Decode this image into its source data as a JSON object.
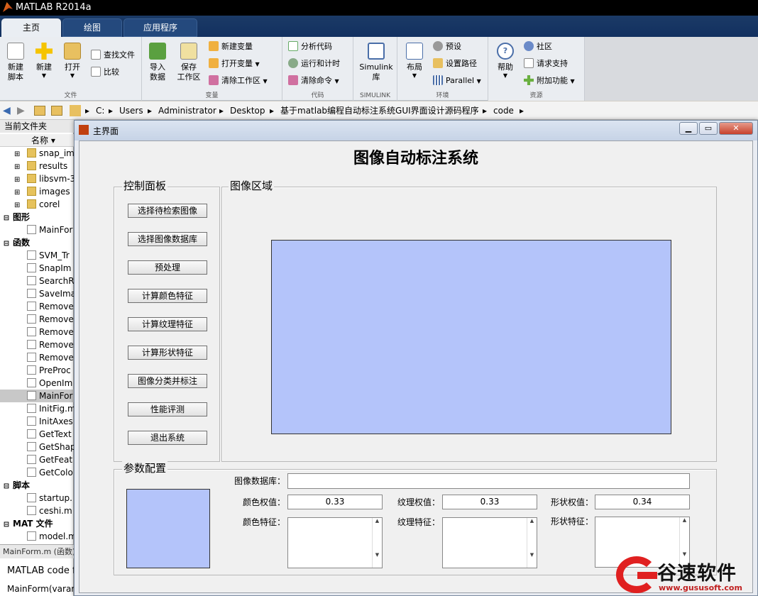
{
  "app": {
    "title": "MATLAB R2014a"
  },
  "tabs": [
    {
      "label": "主页",
      "active": true
    },
    {
      "label": "绘图",
      "active": false
    },
    {
      "label": "应用程序",
      "active": false
    }
  ],
  "ribbon": {
    "file": {
      "section": "文件",
      "new_script": "新建\n脚本",
      "new": "新建",
      "open": "打开",
      "find_files": "查找文件",
      "compare": "比较"
    },
    "variable": {
      "section": "变量",
      "import": "导入\n数据",
      "save_ws": "保存\n工作区",
      "new_var": "新建变量",
      "open_var": "打开变量",
      "clear_ws": "清除工作区"
    },
    "code": {
      "section": "代码",
      "analyze": "分析代码",
      "run_time": "运行和计时",
      "clear_cmd": "清除命令"
    },
    "simulink": {
      "section": "SIMULINK",
      "label": "Simulink\n库"
    },
    "env": {
      "section": "环境",
      "layout": "布局",
      "prefs": "预设",
      "set_path": "设置路径",
      "parallel": "Parallel"
    },
    "resources": {
      "section": "资源",
      "help": "帮助",
      "community": "社区",
      "support": "请求支持",
      "addons": "附加功能"
    }
  },
  "address": {
    "sep": "▸",
    "parts": [
      "C:",
      "Users",
      "Administrator",
      "Desktop",
      "基于matlab编程自动标注系统GUI界面设计源码程序",
      "code"
    ]
  },
  "file_panel": {
    "title": "当前文件夹",
    "col_name": "名称 ▾",
    "items": [
      {
        "label": "snap_im",
        "type": "folder"
      },
      {
        "label": "results",
        "type": "folder"
      },
      {
        "label": "libsvm-3",
        "type": "folder"
      },
      {
        "label": "images",
        "type": "folder"
      },
      {
        "label": "corel",
        "type": "folder"
      },
      {
        "label": "图形",
        "type": "cat"
      },
      {
        "label": "MainFor",
        "type": "file"
      },
      {
        "label": "函数",
        "type": "cat"
      },
      {
        "label": "SVM_Tr",
        "type": "file"
      },
      {
        "label": "SnapIm",
        "type": "file"
      },
      {
        "label": "SearchR",
        "type": "file"
      },
      {
        "label": "SaveIma",
        "type": "file"
      },
      {
        "label": "Remove",
        "type": "file"
      },
      {
        "label": "Remove",
        "type": "file"
      },
      {
        "label": "Remove",
        "type": "file"
      },
      {
        "label": "Remove",
        "type": "file"
      },
      {
        "label": "Remove",
        "type": "file"
      },
      {
        "label": "PreProc",
        "type": "file"
      },
      {
        "label": "OpenIm",
        "type": "file"
      },
      {
        "label": "MainFor",
        "type": "file",
        "selected": true
      },
      {
        "label": "InitFig.m",
        "type": "file"
      },
      {
        "label": "InitAxes",
        "type": "file"
      },
      {
        "label": "GetText",
        "type": "file"
      },
      {
        "label": "GetShap",
        "type": "file"
      },
      {
        "label": "GetFeat",
        "type": "file"
      },
      {
        "label": "GetColo",
        "type": "file"
      },
      {
        "label": "脚本",
        "type": "cat"
      },
      {
        "label": "startup.",
        "type": "file"
      },
      {
        "label": "ceshi.m",
        "type": "file"
      },
      {
        "label": "MAT 文件",
        "type": "cat"
      },
      {
        "label": "model.m",
        "type": "file"
      }
    ],
    "status": "MainForm.m (函数)",
    "code_desc": "MATLAB code fo",
    "fn_sig": "MainForm(varargin)"
  },
  "dialog": {
    "title": "主界面",
    "main_title": "图像自动标注系统",
    "control_panel": "控制面板",
    "image_area": "图像区域",
    "param_panel": "参数配置",
    "buttons": [
      "选择待检索图像",
      "选择图像数据库",
      "预处理",
      "计算颜色特征",
      "计算纹理特征",
      "计算形状特征",
      "图像分类并标注",
      "性能评测",
      "退出系统"
    ],
    "params": {
      "db_label": "图像数据库：",
      "db_value": "",
      "color_w_label": "颜色权值：",
      "color_w": "0.33",
      "texture_w_label": "纹理权值：",
      "texture_w": "0.33",
      "shape_w_label": "形状权值：",
      "shape_w": "0.34",
      "color_f_label": "颜色特征：",
      "texture_f_label": "纹理特征：",
      "shape_f_label": "形状特征："
    }
  },
  "watermark": {
    "name": "谷速软件",
    "url": "www.gususoft.com"
  },
  "colors": {
    "axes": "#b4c4fa",
    "tab_bar": "#1b3a66"
  }
}
